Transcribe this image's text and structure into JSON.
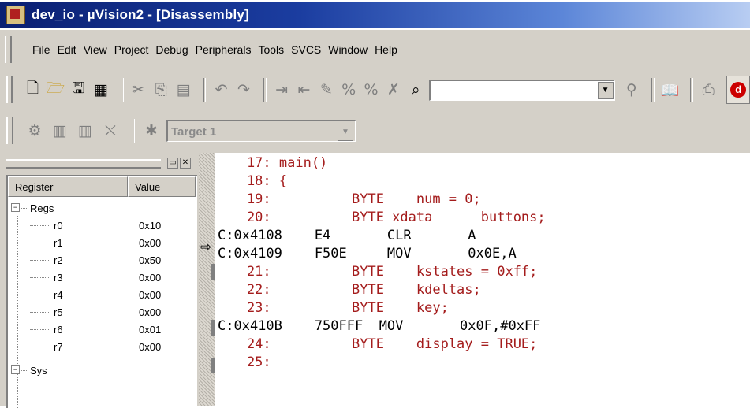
{
  "window": {
    "title": "dev_io  - µVision2 - [Disassembly]"
  },
  "menu": [
    "File",
    "Edit",
    "View",
    "Project",
    "Debug",
    "Peripherals",
    "Tools",
    "SVCS",
    "Window",
    "Help"
  ],
  "toolbar": {
    "icons": [
      "new-file-icon",
      "open-folder-icon",
      "save-icon",
      "save-all-icon",
      "cut-icon",
      "copy-icon",
      "paste-icon",
      "undo-icon",
      "redo-icon",
      "indent-icon",
      "outdent-icon",
      "comment-icon",
      "uncomment-icon",
      "bookmark-icon",
      "bookmark-clear-icon",
      "find-in-files-icon",
      "find-icon",
      "manual-icon",
      "print-icon",
      "debug-session-icon"
    ],
    "find_value": ""
  },
  "build_toolbar": {
    "target": "Target 1"
  },
  "register_window": {
    "columns": [
      "Register",
      "Value"
    ],
    "group": "Regs",
    "registers": [
      {
        "name": "r0",
        "value": "0x10"
      },
      {
        "name": "r1",
        "value": "0x00"
      },
      {
        "name": "r2",
        "value": "0x50"
      },
      {
        "name": "r3",
        "value": "0x00"
      },
      {
        "name": "r4",
        "value": "0x00"
      },
      {
        "name": "r5",
        "value": "0x00"
      },
      {
        "name": "r6",
        "value": "0x01"
      },
      {
        "name": "r7",
        "value": "0x00"
      }
    ],
    "next_group": "Sys"
  },
  "disassembly": [
    {
      "kind": "src",
      "text": "    17: main()"
    },
    {
      "kind": "src",
      "text": "    18: {"
    },
    {
      "kind": "src",
      "text": "    19:          BYTE    num = 0;"
    },
    {
      "kind": "src",
      "text": "    20:          BYTE xdata      buttons;"
    },
    {
      "kind": "asm",
      "text": "C:0x4108    E4       CLR       A",
      "current": true
    },
    {
      "kind": "asm",
      "text": "C:0x4109    F50E     MOV       0x0E,A"
    },
    {
      "kind": "src",
      "text": "    21:          BYTE    kstates = 0xff;"
    },
    {
      "kind": "src",
      "text": "    22:          BYTE    kdeltas;"
    },
    {
      "kind": "src",
      "text": "    23:          BYTE    key;"
    },
    {
      "kind": "asm",
      "text": "C:0x410B    750FFF  MOV       0x0F,#0xFF"
    },
    {
      "kind": "src",
      "text": "    24:          BYTE    display = TRUE;"
    },
    {
      "kind": "src",
      "text": "    25:"
    }
  ]
}
